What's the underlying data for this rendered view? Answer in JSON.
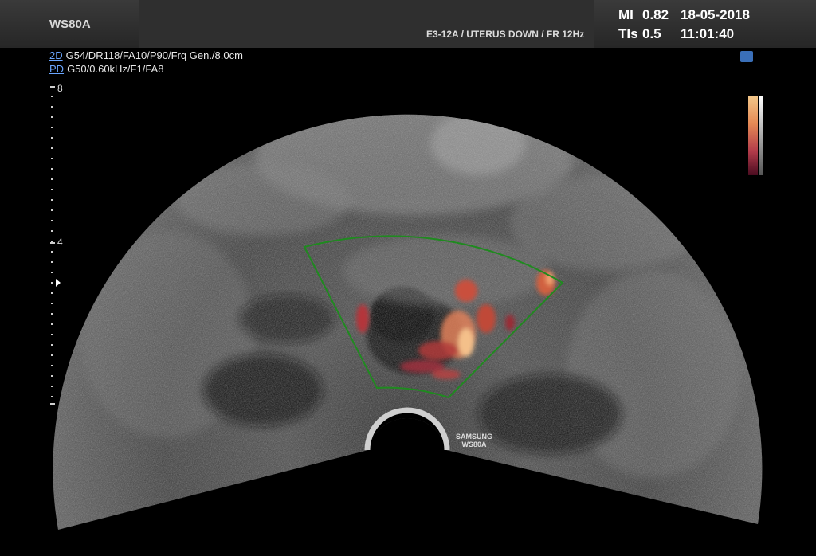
{
  "header": {
    "model": "WS80A",
    "preset": "E3-12A / UTERUS DOWN / FR 12Hz",
    "mi_label": "MI",
    "mi_value": "0.82",
    "tis_label": "TIs",
    "tis_value": "0.5",
    "date": "18-05-2018",
    "time": "11:01:40"
  },
  "params": {
    "mode_2d": "2D",
    "params_2d": "G54/DR118/FA10/P90/Frq Gen./8.0cm",
    "mode_pd": "PD",
    "params_pd": "G50/0.60kHz/F1/FA8"
  },
  "depth_scale": {
    "top": "8",
    "mid": "4"
  },
  "watermark": {
    "line1": "SAMSUNG",
    "line2": "WS80A"
  },
  "colors": {
    "roi_box": "#1f8a1f",
    "doppler_hot": "#f0a070",
    "doppler_cold": "#8a1a2a"
  },
  "icons": [
    "eye-icon",
    "focus-marker-icon"
  ]
}
